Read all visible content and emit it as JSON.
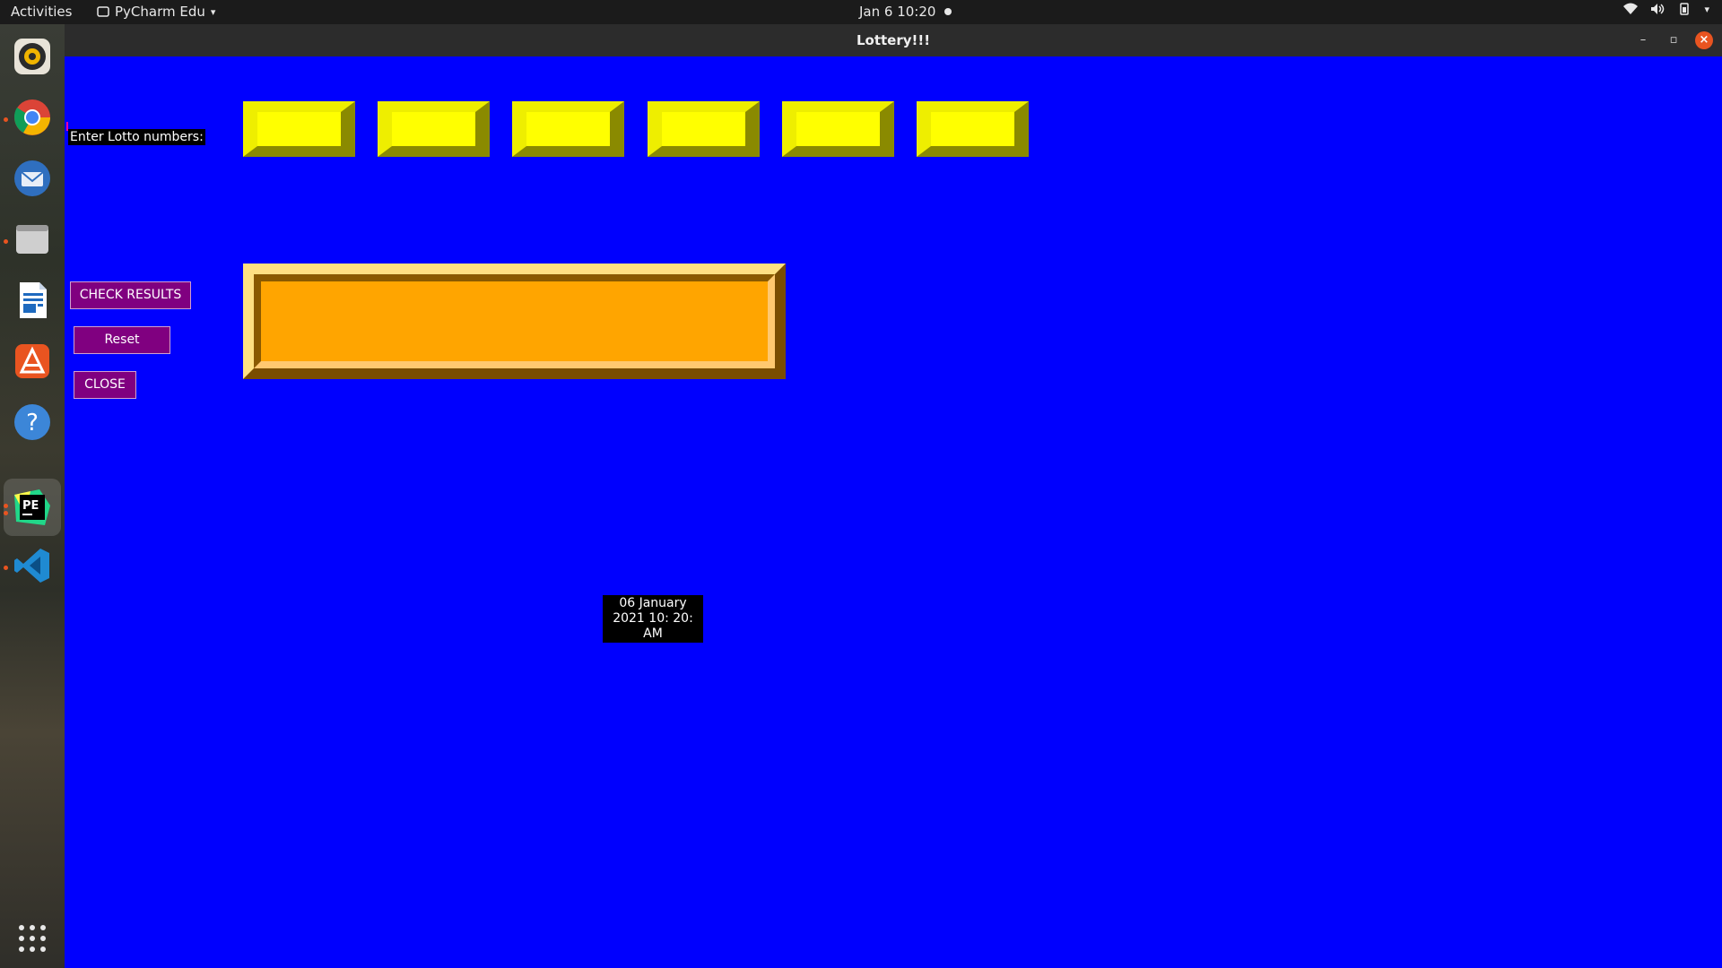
{
  "topbar": {
    "activities": "Activities",
    "app_menu": "PyCharm Edu",
    "clock": "Jan 6  10:20"
  },
  "dock": {
    "items": [
      "rhythmbox-icon",
      "chrome-icon",
      "thunderbird-icon",
      "files-icon",
      "writer-icon",
      "software-center-icon",
      "help-icon",
      "pycharm-edu-icon",
      "vscode-icon"
    ],
    "show_apps": "grid-icon"
  },
  "window": {
    "title": "Lottery!!!"
  },
  "app": {
    "lotto_label": "Enter Lotto numbers:",
    "entries": [
      "",
      "",
      "",
      "",
      "",
      ""
    ],
    "result": "",
    "check_button": "CHECK RESULTS",
    "reset_button": "Reset",
    "close_button": "CLOSE",
    "date_line1": "06 January",
    "date_line2": "2021 10: 20: AM"
  },
  "colors": {
    "background": "#0000fe",
    "entry": "#ffff00",
    "result": "#ffa500",
    "button": "#800080"
  }
}
